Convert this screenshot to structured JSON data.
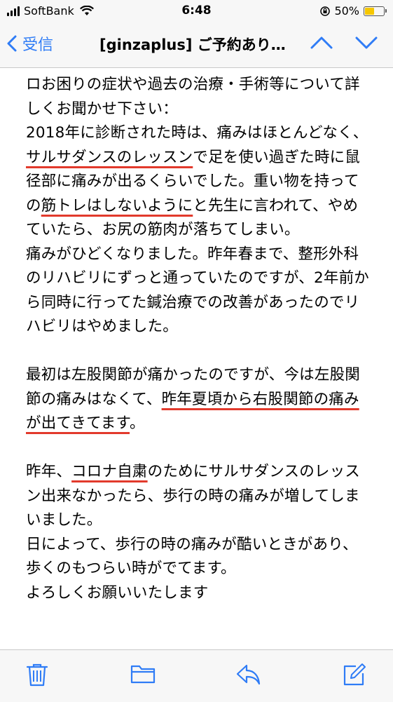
{
  "status_bar": {
    "carrier": "SoftBank",
    "time": "6:48",
    "battery_percent": "50%",
    "battery_level": 0.5,
    "battery_color": "#f6c700"
  },
  "nav": {
    "back_label": "受信",
    "title": "[ginzaplus] ご予約あり…",
    "accent_color": "#2f7cf6",
    "up_icon": "chevron-up-icon",
    "down_icon": "chevron-down-icon"
  },
  "email": {
    "paragraphs": [
      {
        "segments": [
          {
            "text": "ロお困りの症状や過去の治療・手術等について詳しくお聞かせ下さい："
          }
        ]
      },
      {
        "segments": [
          {
            "text": "2018年に診断された時は、痛みはほとんどなく、"
          },
          {
            "text": "サルサダンスのレッスン",
            "underline": true
          },
          {
            "text": "で足を使い過ぎた時に鼠径部に痛みが出るくらいでした。重い物を持っての"
          },
          {
            "text": "筋トレはしないように",
            "underline": true
          },
          {
            "text": "と先生に言われて、やめていたら、お尻の筋肉が落ちてしまい。"
          }
        ]
      },
      {
        "segments": [
          {
            "text": "痛みがひどくなりました。昨年春まで、整形外科のリハビリにずっと通っていたのですが、2年前から同時に行ってた鍼治療での改善があったのでリハビリはやめました。"
          }
        ]
      },
      {
        "segments": [
          {
            "text": " "
          }
        ]
      },
      {
        "segments": [
          {
            "text": "最初は左股関節が痛かったのですが、今は左股関節の痛みはなくて、"
          },
          {
            "text": "昨年夏頃から右股関節の痛みが出てきてます",
            "underline": true
          },
          {
            "text": "。"
          }
        ]
      },
      {
        "segments": [
          {
            "text": " "
          }
        ]
      },
      {
        "segments": [
          {
            "text": "昨年、"
          },
          {
            "text": "コロナ自粛",
            "underline": true
          },
          {
            "text": "のためにサルサダンスのレッスン出来なかったら、歩行の時の痛みが増してしまいました。"
          }
        ]
      },
      {
        "segments": [
          {
            "text": "日によって、歩行の時の痛みが酷いときがあり、歩くのもつらい時がでてます。"
          }
        ]
      },
      {
        "segments": [
          {
            "text": "よろしくお願いいたします"
          }
        ]
      }
    ],
    "underline_color": "#e23a2c"
  },
  "toolbar": {
    "icons": [
      "trash-icon",
      "folder-icon",
      "reply-icon",
      "compose-icon"
    ]
  }
}
